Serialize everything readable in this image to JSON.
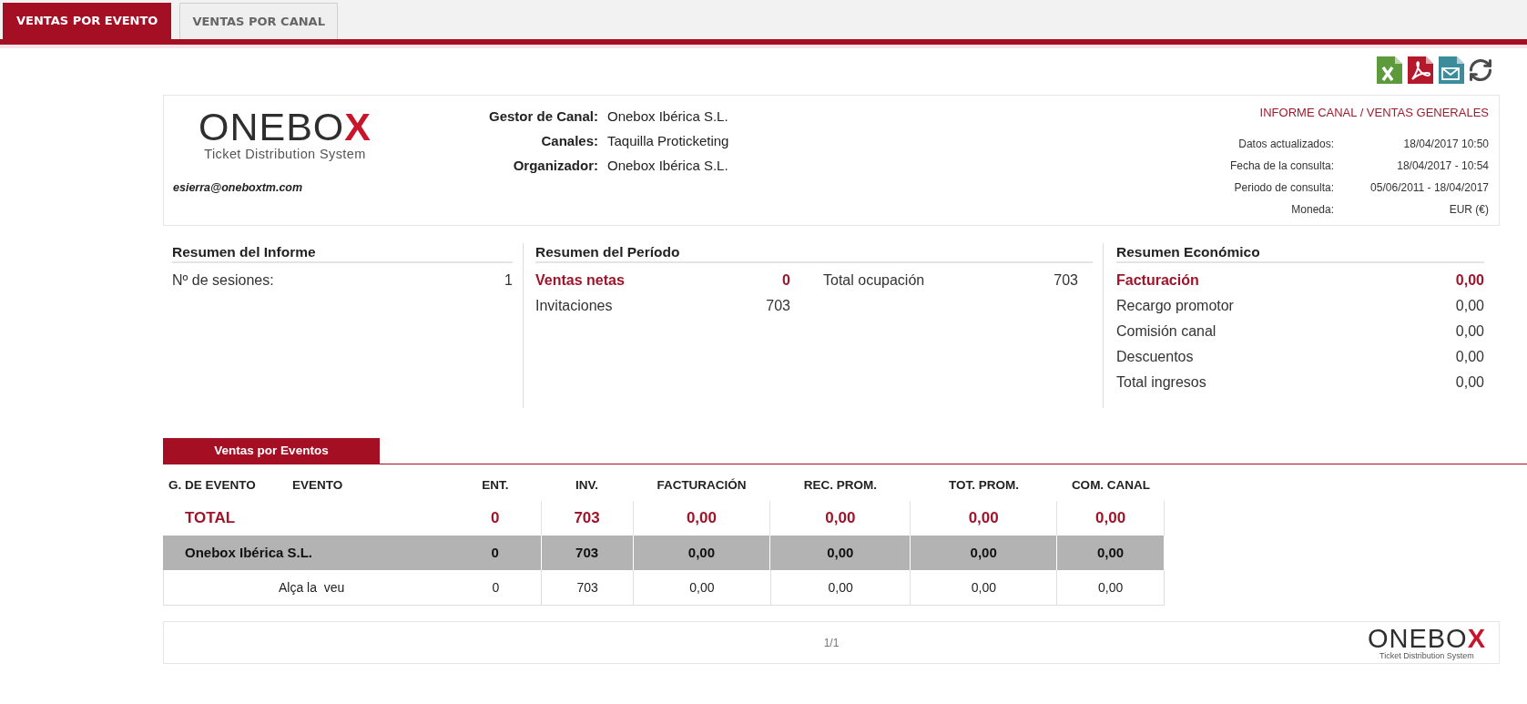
{
  "tabs": [
    {
      "label": "VENTAS POR EVENTO",
      "selected": true
    },
    {
      "label": "VENTAS POR CANAL",
      "selected": false
    }
  ],
  "report_header": {
    "logo": {
      "text": "ONEBO",
      "accent": "X",
      "tagline": "Ticket Distribution System"
    },
    "email": "esierra@oneboxtm.com",
    "info": [
      {
        "label": "Gestor de Canal:",
        "value": "Onebox Ibérica S.L."
      },
      {
        "label": "Canales:",
        "value": "Taquilla Proticketing"
      },
      {
        "label": "Organizador:",
        "value": "Onebox Ibérica S.L."
      }
    ],
    "title": "INFORME CANAL / VENTAS GENERALES",
    "meta": [
      {
        "label": "Datos actualizados:",
        "value": "18/04/2017 10:50"
      },
      {
        "label": "Fecha de la consulta:",
        "value": "18/04/2017 - 10:54"
      },
      {
        "label": "Periodo de consulta:",
        "value": "05/06/2011 - 18/04/2017"
      },
      {
        "label": "Moneda:",
        "value": "EUR (€)"
      }
    ]
  },
  "summaries": [
    {
      "title": "Resumen del Informe",
      "columns": [
        [
          {
            "label": "Nº de sesiones:",
            "value": "1",
            "emphasized": false
          }
        ]
      ]
    },
    {
      "title": "Resumen del Período",
      "columns": [
        [
          {
            "label": "Ventas netas",
            "value": "0",
            "emphasized": true
          },
          {
            "label": "Invitaciones",
            "value": "703",
            "emphasized": false
          }
        ],
        [
          {
            "label": "Total ocupación",
            "value": "703",
            "emphasized": false
          }
        ]
      ]
    },
    {
      "title": "Resumen Económico",
      "columns": [
        [
          {
            "label": "Facturación",
            "value": "0,00",
            "emphasized": true
          },
          {
            "label": "Recargo promotor",
            "value": "0,00",
            "emphasized": false
          },
          {
            "label": "Comisión canal",
            "value": "0,00",
            "emphasized": false
          },
          {
            "label": "Descuentos",
            "value": "0,00",
            "emphasized": false
          },
          {
            "label": "Total ingresos",
            "value": "0,00",
            "emphasized": false
          }
        ]
      ]
    }
  ],
  "events_table": {
    "title": "Ventas por Eventos",
    "columns": [
      "G. DE EVENTO",
      "EVENTO",
      "ENT.",
      "INV.",
      "FACTURACIÓN",
      "REC. PROM.",
      "TOT. PROM.",
      "COM. CANAL"
    ],
    "rows": [
      {
        "kind": "total",
        "name": "TOTAL",
        "values": [
          "0",
          "703",
          "0,00",
          "0,00",
          "0,00",
          "0,00"
        ]
      },
      {
        "kind": "group",
        "name": "Onebox Ibérica S.L.",
        "values": [
          "0",
          "703",
          "0,00",
          "0,00",
          "0,00",
          "0,00"
        ]
      },
      {
        "kind": "event",
        "name": "Alça la  veu",
        "values": [
          "0",
          "703",
          "0,00",
          "0,00",
          "0,00",
          "0,00"
        ]
      }
    ]
  },
  "footer": {
    "page": "1/1",
    "logo": {
      "text": "ONEBO",
      "accent": "X",
      "tagline": "Ticket Distribution System"
    }
  }
}
